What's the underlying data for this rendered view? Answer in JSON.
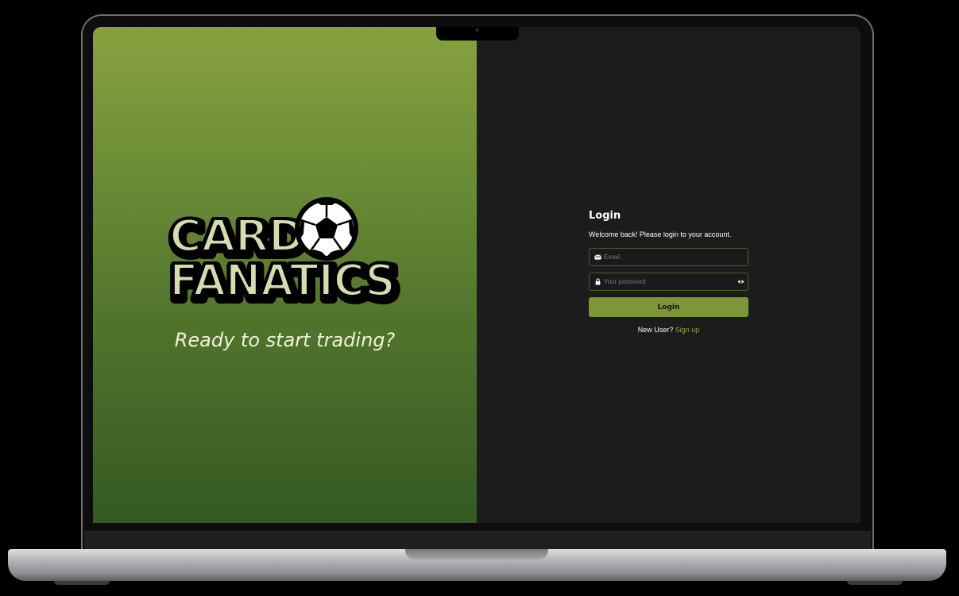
{
  "brand": {
    "logo_line1": "CARD",
    "logo_line2": "FANATICS",
    "tagline": "Ready to start trading?"
  },
  "login": {
    "title": "Login",
    "subtitle": "Welcome back! Please login to your account.",
    "email": {
      "placeholder": "Email",
      "value": "",
      "icon": "envelope-icon"
    },
    "password": {
      "placeholder": "Your password",
      "value": "",
      "icon": "lock-icon",
      "toggle_icon": "eye-icon"
    },
    "button_label": "Login",
    "signup_prompt": "New User?",
    "signup_link": "Sign up"
  },
  "colors": {
    "accent": "#7c9638",
    "link": "#8cab43",
    "panel_dark": "#1c1c1c",
    "gradient_top": "#87a13f",
    "gradient_bottom": "#355a22",
    "logo_fill": "#d4dcb0"
  }
}
